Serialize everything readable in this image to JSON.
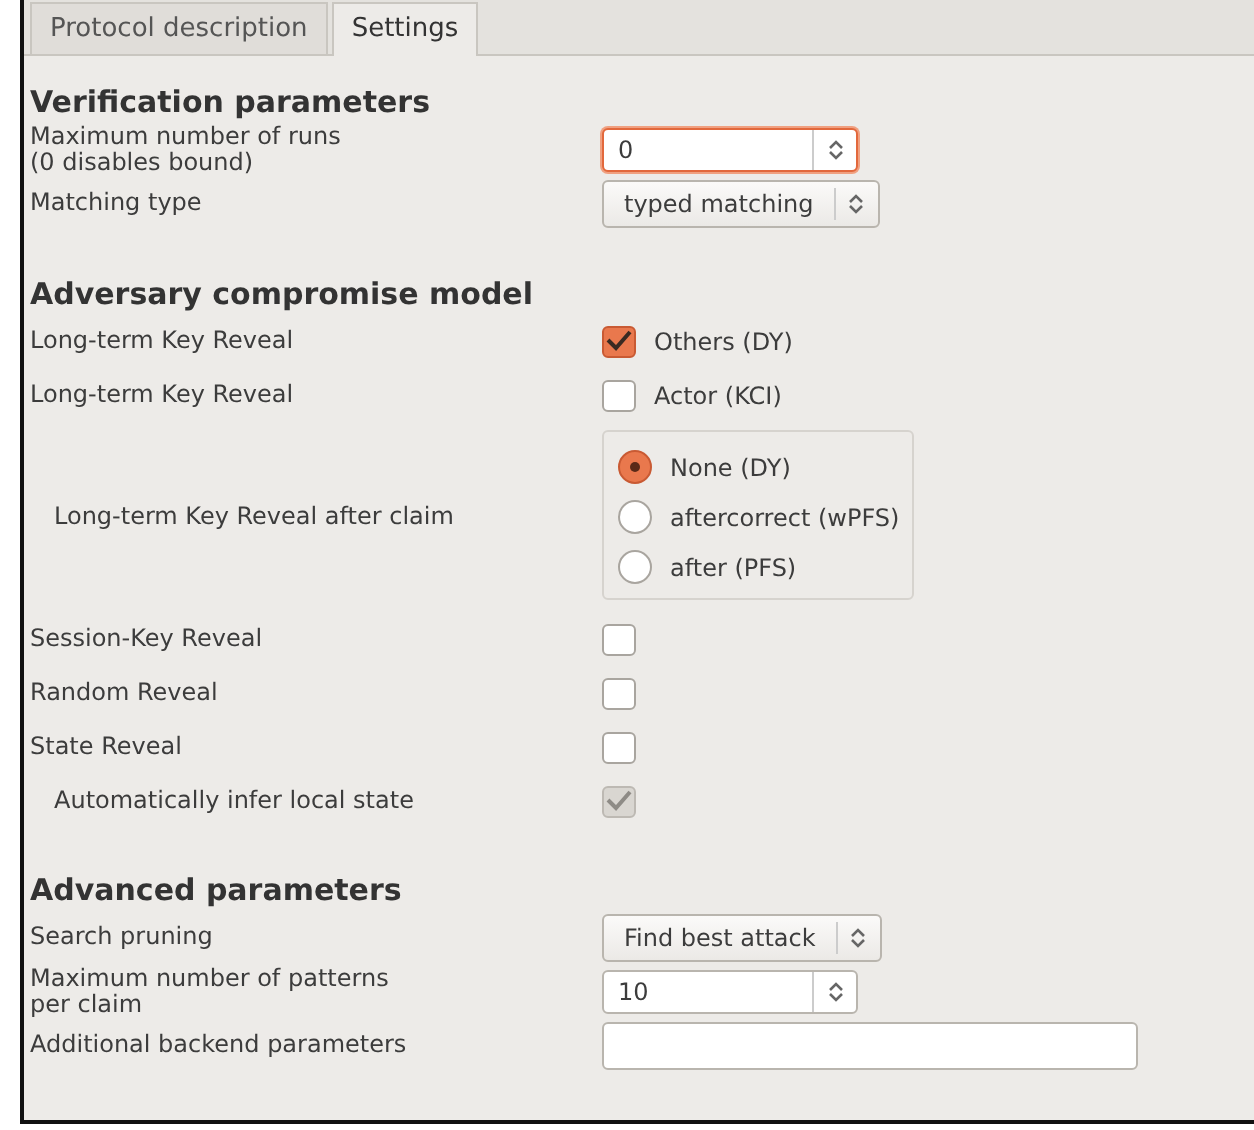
{
  "tabs": [
    {
      "label": "Protocol description",
      "selected": false
    },
    {
      "label": "Settings",
      "selected": true
    }
  ],
  "sections": [
    {
      "title": "Verification parameters",
      "rows": [
        {
          "kind": "spin",
          "label": "Maximum number of runs\n(0 disables bound)",
          "value": "0",
          "focused": true
        },
        {
          "kind": "combo",
          "label": "Matching type",
          "value": "typed matching"
        }
      ]
    },
    {
      "title": "Adversary compromise model",
      "rows": [
        {
          "kind": "check",
          "label": "Long-term Key Reveal",
          "option": "Others (DY)",
          "checked": true,
          "disabled": false,
          "indented": false
        },
        {
          "kind": "check",
          "label": "Long-term Key Reveal",
          "option": "Actor (KCI)",
          "checked": false,
          "disabled": false,
          "indented": false
        },
        {
          "kind": "radio",
          "label": "Long-term Key Reveal after claim",
          "indented": true,
          "options": [
            {
              "label": "None (DY)",
              "selected": true
            },
            {
              "label": "aftercorrect (wPFS)",
              "selected": false
            },
            {
              "label": "after (PFS)",
              "selected": false
            }
          ]
        },
        {
          "kind": "check",
          "label": "Session-Key Reveal",
          "checked": false,
          "disabled": false,
          "indented": false
        },
        {
          "kind": "check",
          "label": "Random Reveal",
          "checked": false,
          "disabled": false,
          "indented": false
        },
        {
          "kind": "check",
          "label": "State Reveal",
          "checked": false,
          "disabled": false,
          "indented": false
        },
        {
          "kind": "check",
          "label": "Automatically infer local state",
          "checked": true,
          "disabled": true,
          "indented": true
        }
      ]
    },
    {
      "title": "Advanced parameters",
      "rows": [
        {
          "kind": "combo",
          "label": "Search pruning",
          "value": "Find best attack"
        },
        {
          "kind": "spin",
          "label": "Maximum number of patterns\nper claim",
          "value": "10",
          "focused": false
        },
        {
          "kind": "text",
          "label": "Additional backend parameters"
        }
      ]
    }
  ]
}
